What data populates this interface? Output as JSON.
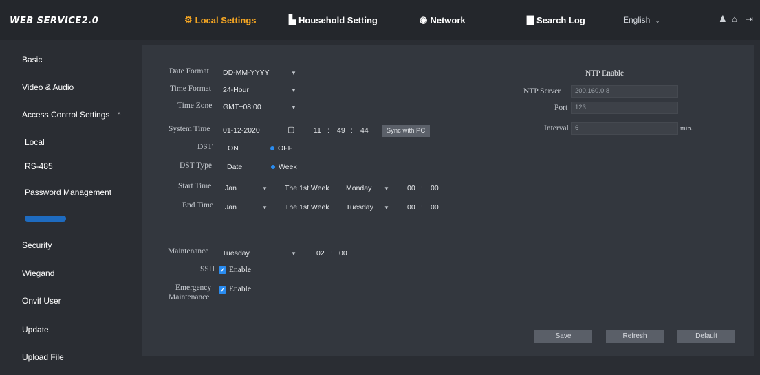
{
  "header": {
    "logo": "WEB SERVICE2.0",
    "nav": [
      {
        "label": "Local Settings",
        "icon": "gear-icon"
      },
      {
        "label": "Household Setting",
        "icon": "building-icon"
      },
      {
        "label": "Network",
        "icon": "globe-icon"
      },
      {
        "label": "Search Log",
        "icon": "document-icon"
      }
    ],
    "language": "English",
    "accent_color": "#f5a623"
  },
  "sidebar": {
    "items": [
      {
        "label": "Basic"
      },
      {
        "label": "Video & Audio"
      },
      {
        "label": "Access Control Settings"
      },
      {
        "label": "Local"
      },
      {
        "label": "RS-485"
      },
      {
        "label": "Password Management"
      },
      {
        "label": ""
      },
      {
        "label": "Security"
      },
      {
        "label": "Wiegand"
      },
      {
        "label": "Onvif User"
      },
      {
        "label": "Update"
      },
      {
        "label": "Upload File"
      }
    ],
    "active_color": "#1e88e5"
  },
  "form": {
    "date_format": {
      "label": "Date Format",
      "value": "DD-MM-YYYY"
    },
    "time_format": {
      "label": "Time Format",
      "value": "24-Hour"
    },
    "time_zone": {
      "label": "Time Zone",
      "value": "GMT+08:00"
    },
    "system_time": {
      "label": "System Time",
      "date": "01-12-2020",
      "hour": "11",
      "minute": "49",
      "second": "44",
      "sync_label": "Sync with PC"
    },
    "dst": {
      "label": "DST",
      "on": "ON",
      "off": "OFF",
      "selected": "OFF"
    },
    "dst_type": {
      "label": "DST Type",
      "date": "Date",
      "week": "Week",
      "selected": "Week"
    },
    "start_time": {
      "label": "Start Time",
      "month": "Jan",
      "week": "The 1st Week",
      "day": "Monday",
      "hour": "00",
      "minute": "00"
    },
    "end_time": {
      "label": "End Time",
      "month": "Jan",
      "week": "The 1st Week",
      "day": "Tuesday",
      "hour": "00",
      "minute": "00"
    },
    "maintenance": {
      "label": "Maintenance",
      "day": "Tuesday",
      "hour": "02",
      "minute": "00"
    },
    "ssh": {
      "label": "SSH",
      "text": "Enable",
      "checked": true
    },
    "emergency": {
      "label_1": "Emergency",
      "label_2": "Maintenance",
      "text": "Enable",
      "checked": true
    }
  },
  "ntp": {
    "title": "NTP Enable",
    "server": {
      "label": "NTP Server",
      "value": "200.160.0.8"
    },
    "port": {
      "label": "Port",
      "value": "123"
    },
    "interval": {
      "label": "Interval",
      "value": "6",
      "unit": "min."
    }
  },
  "buttons": {
    "save": "Save",
    "refresh": "Refresh",
    "default": "Default"
  }
}
